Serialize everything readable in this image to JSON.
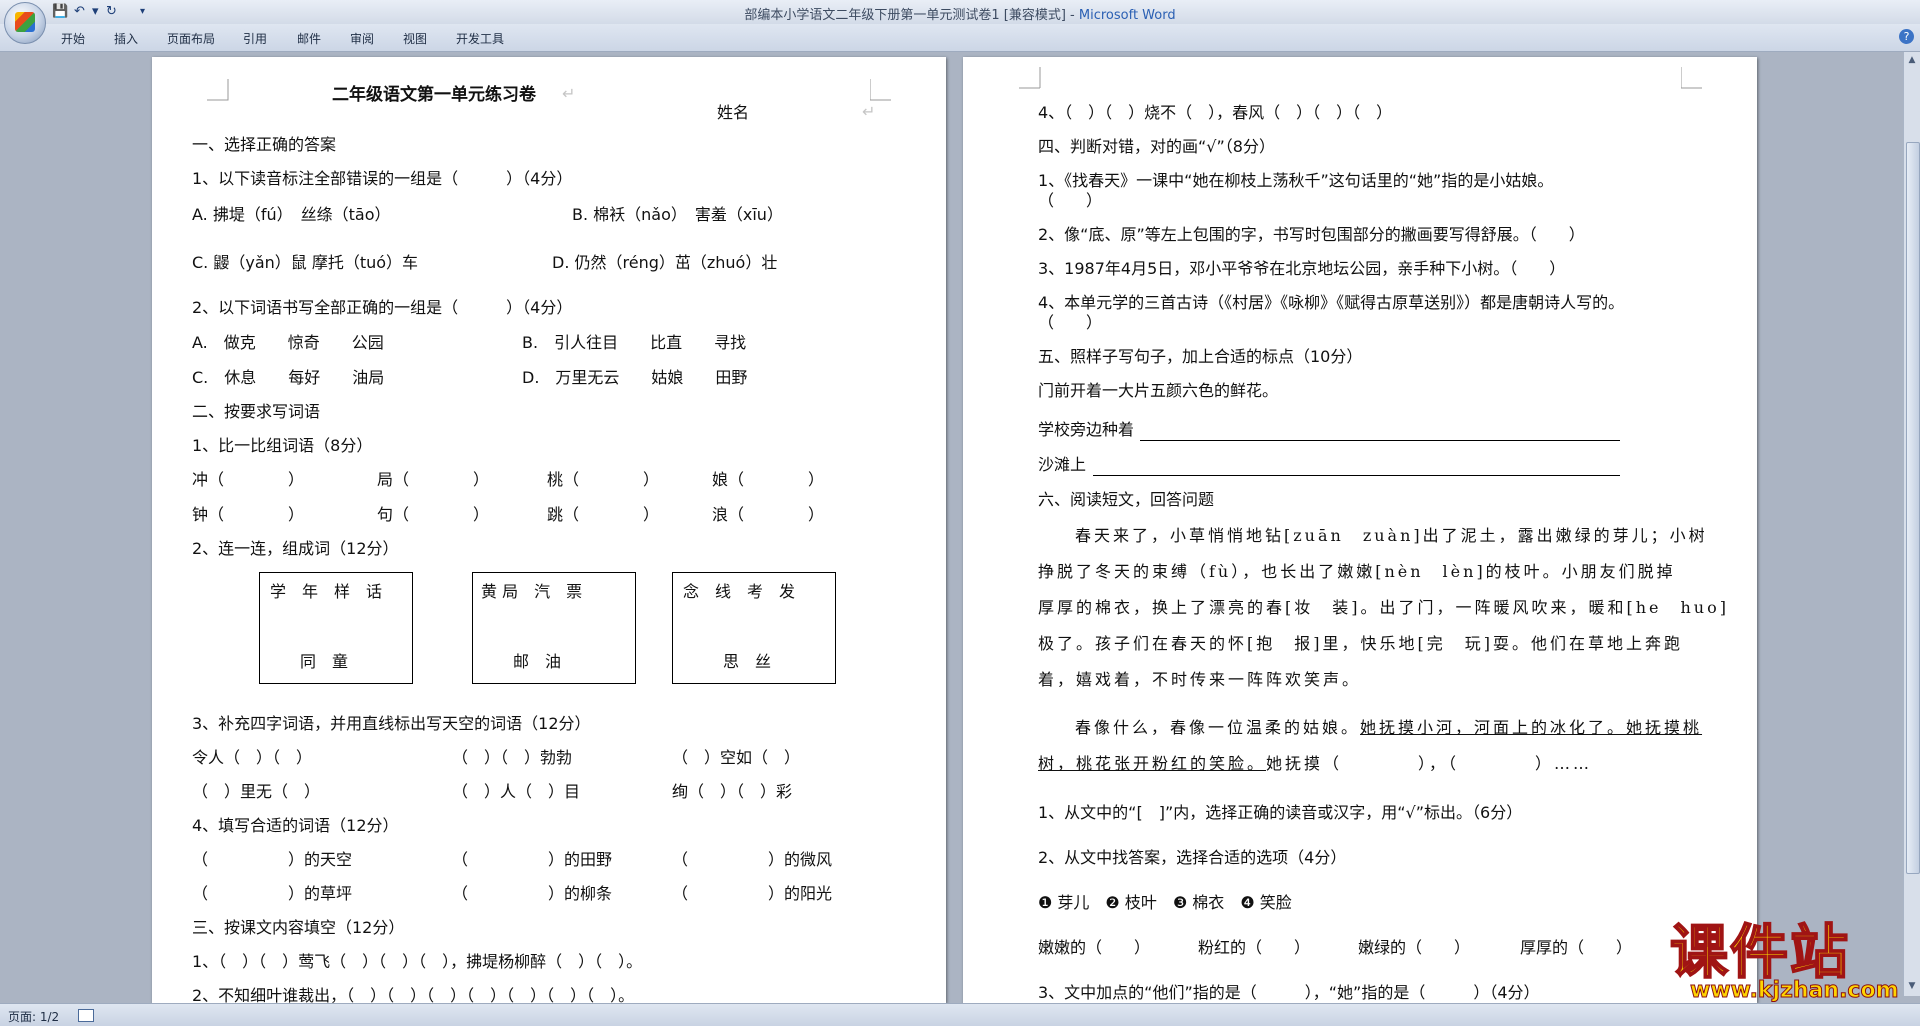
{
  "window": {
    "title_doc": "部编本小学语文二年级下册第一单元测试卷1 [兼容模式] - ",
    "title_app": "Microsoft Word"
  },
  "quick_access": {
    "dropdown": "▾"
  },
  "ribbon": {
    "tabs": [
      "开始",
      "插入",
      "页面布局",
      "引用",
      "邮件",
      "审阅",
      "视图",
      "开发工具"
    ],
    "help": "?"
  },
  "status": {
    "page": "页面: 1/2"
  },
  "mark": "↵",
  "left": {
    "title": "二年级语文第一单元练习卷",
    "name_label": "姓名",
    "s1": "一、选择正确的答案",
    "q1": "1、以下读音标注全部错误的一组是（　　　）（4分）",
    "q1_a": "A. 拂堤（fú）　丝绦（tāo）",
    "q1_b": "B. 棉袄（nǎo）　害羞（xīu）",
    "q1_c": "C. 鼹（yǎn）鼠 摩托（tuó）车",
    "q1_d": "D. 仍然（réng）茁（zhuó）壮",
    "q2": "2、以下词语书写全部正确的一组是（　　　）（4分）",
    "q2_a": "A.　做克　　惊奇　　公园",
    "q2_b": "B.　引人往目　　比直　　寻找",
    "q2_c": "C.　休息　　每好　　油局",
    "q2_d": "D.　万里无云　　姑娘　　田野",
    "s2": "二、按要求写词语",
    "q3": "1、比一比组词语（8分）",
    "q3_r1": [
      "冲（　　　　）",
      "局（　　　　）",
      "桃（　　　　）",
      "娘（　　　　）"
    ],
    "q3_r2": [
      "钟（　　　　）",
      "句（　　　　）",
      "跳（　　　　）",
      "浪（　　　　）"
    ],
    "q4": "2、连一连，组成词（12分）",
    "q4_boxes": [
      {
        "top": "学　年　样　话",
        "bottom": "同　童"
      },
      {
        "top": "黄 局　汽　票",
        "bottom": "邮　油"
      },
      {
        "top": "念　线　考　发",
        "bottom": "思　丝"
      }
    ],
    "q5": "3、补充四字词语，并用直线标出写天空的词语（12分）",
    "q5_r1": [
      "令人（　）（　）",
      "（　）（　）勃勃",
      "（　）空如（　）"
    ],
    "q5_r2": [
      "（　）里无（　）",
      "（　）人（　）目",
      "绚（　）（　）彩"
    ],
    "q6": "4、填写合适的词语（12分）",
    "q6_r1": [
      "（　　　　　）的天空",
      "（　　　　　）的田野",
      "（　　　　　）的微风"
    ],
    "q6_r2": [
      "（　　　　　）的草坪",
      "（　　　　　）的柳条",
      "（　　　　　）的阳光"
    ],
    "s3": "三、按课文内容填空（12分）",
    "q7": "1、（　）（　）莺飞（　）（　）（　），拂堤杨柳醉（　）（　）。",
    "q8": "2、不知细叶谁裁出，（　）（　）（　）（　）（　）（　）（　）。"
  },
  "right": {
    "q9": "4、（　）（　）烧不（　），春风（　）（　）（　）",
    "s4": "四、判断对错，对的画“√”（8分）",
    "j1a": "1、《找春天》一课中“她在柳枝上荡秋千”这句话里的“她”指的是小姑娘。",
    "j1b": "（　　）",
    "j2": "2、像“底、原”等左上包围的字，书写时包围部分的撇画要写得舒展。（　　）",
    "j3": "3、1987年4月5日，邓小平爷爷在北京地坛公园，亲手种下小树。（　　）",
    "j4a": "4、本单元学的三首古诗（《村居》《咏柳》《赋得古原草送别》）都是唐朝诗人写的。",
    "j4b": "（　　）",
    "s5": "五、照样子写句子，加上合适的标点（10分）",
    "example": "门前开着一大片五颜六色的鲜花。",
    "w1": "学校旁边种着",
    "w2": "沙滩上",
    "s6": "六、阅读短文，回答问题",
    "p1": [
      "春天来了，小草悄悄地钻[zuān　zuàn]出了泥土，露出嫩绿的芽儿；小树",
      "挣脱了冬天的束缚（fù），也长出了嫩嫩[nèn　lèn]的枝叶。小朋友们脱掉",
      "厚厚的棉衣，换上了漂亮的春[妆　装]。出了门，一阵暖风吹来，暖和[he　huo]",
      "极了。孩子们在春天的怀[抱　报]里，快乐地[完　玩]耍。他们在草地上奔跑",
      "着，嬉戏着，不时传来一阵阵欢笑声。"
    ],
    "p2a_plain": "春像什么，春像一位温柔的姑娘。",
    "p2a_under": "她抚摸小河，河面上的冰化了。她抚摸桃",
    "p2b_under": "树，桃花张开粉红的笑脸。",
    "p2b_plain": "她抚摸（　　　　），（　　　　）……",
    "r1": "1、从文中的“[　]”内，选择正确的读音或汉字，用“√”标出。（6分）",
    "r2": "2、从文中找答案，选择合适的选项（4分）",
    "opts": "❶ 芽儿　❷ 枝叶　❸ 棉衣　❹ 笑脸",
    "fills": [
      "嫩嫩的（　　）",
      "粉红的（　　）",
      "嫩绿的（　　）",
      "厚厚的（　　）"
    ],
    "r3": "3、文中加点的“他们”指的是（　　　），“她”指的是（　　　）（4分）"
  },
  "watermark": {
    "text": "课件站",
    "url": "www.kjzhan.com"
  }
}
